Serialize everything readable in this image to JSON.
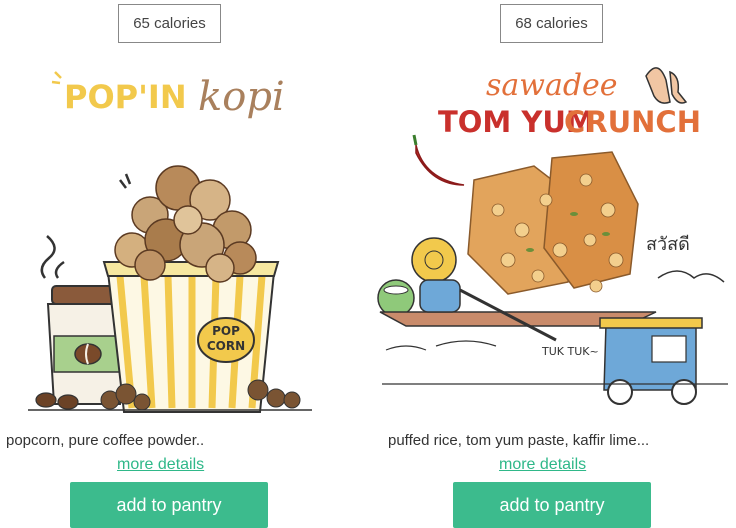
{
  "products": [
    {
      "calories": "65 calories",
      "brand_word_1": "POP'IN",
      "brand_word_2": "kopi",
      "popcorn_label_1": "POP",
      "popcorn_label_2": "CORN",
      "description": "popcorn, pure coffee powder..",
      "more_details": "more details",
      "button": "add to pantry",
      "colors": {
        "brand_yellow": "#f2c94c",
        "brand_brown": "#a9805d"
      }
    },
    {
      "calories": "68 calories",
      "brand_top": "sawadee",
      "brand_bottom_1": "TOM YUM",
      "brand_bottom_2": "CRUNCH",
      "thai_text": "สวัสดี",
      "tuk_tuk_label": "TUK TUK~",
      "description": "puffed rice, tom yum paste, kaffir lime...",
      "more_details": "more details",
      "button": "add to pantry",
      "colors": {
        "brand_red": "#c9302c",
        "brand_orange": "#e2703a"
      }
    }
  ],
  "colors": {
    "accent_green": "#3cbb8d",
    "link_green": "#2fb889"
  }
}
